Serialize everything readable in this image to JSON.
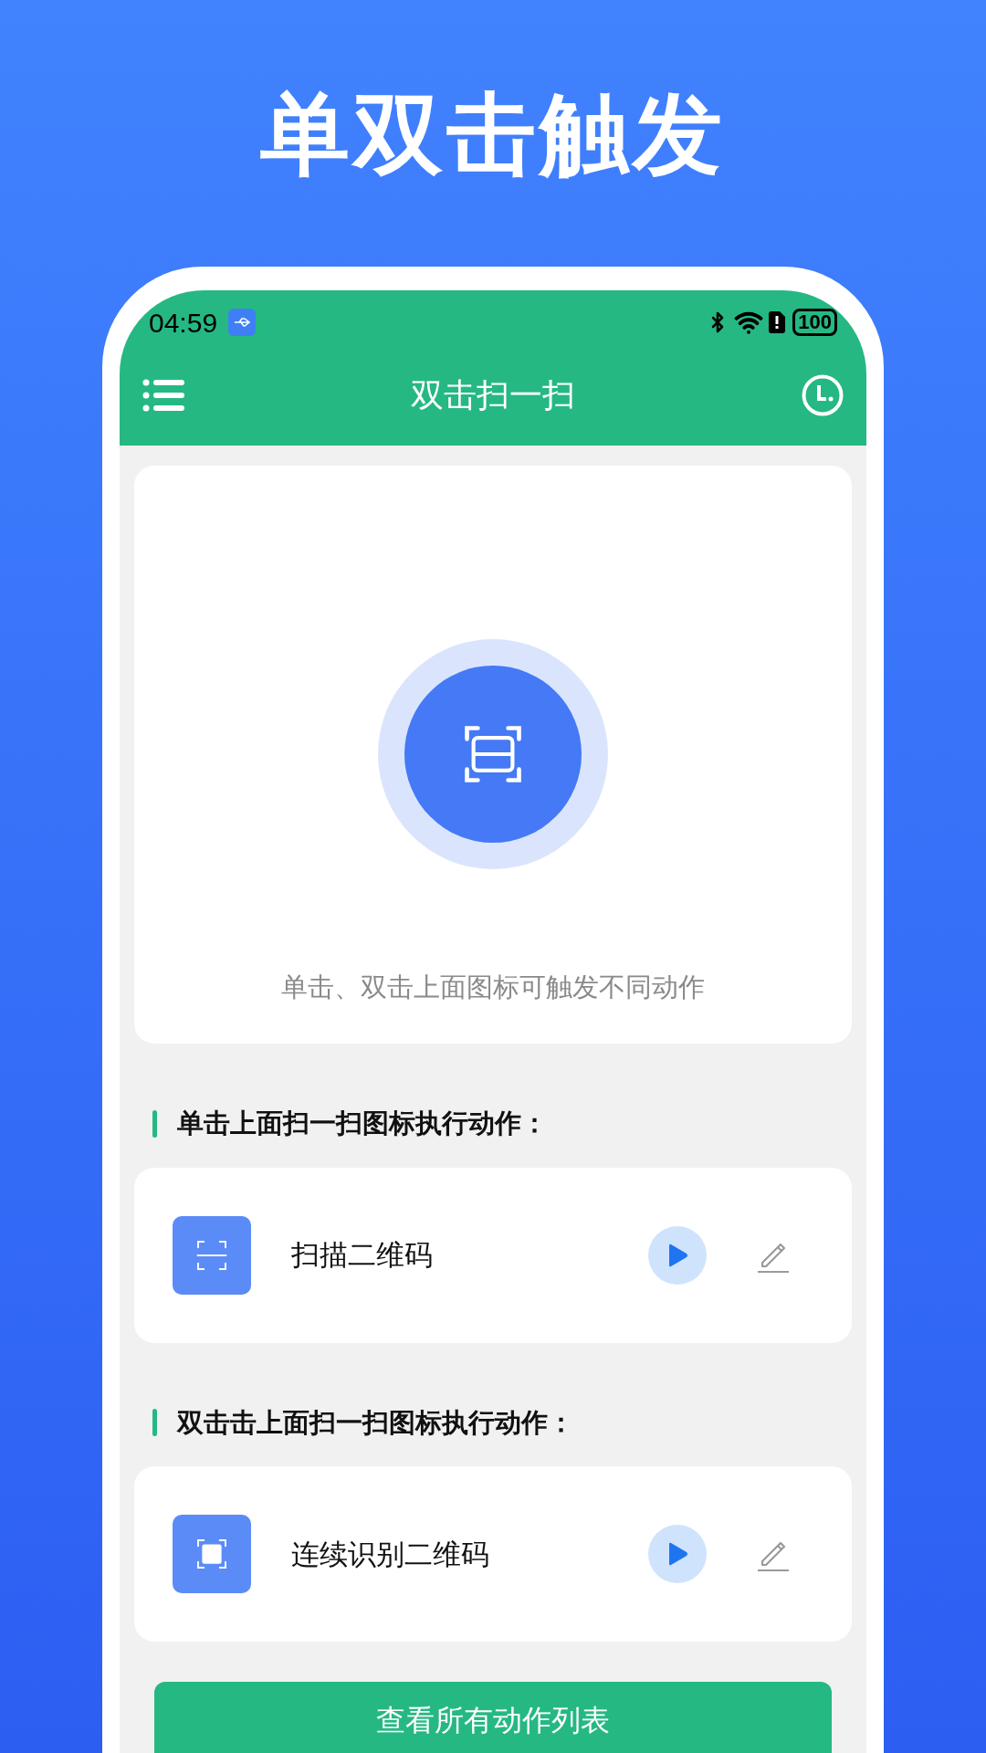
{
  "headline": "单双击触发",
  "status_bar": {
    "time": "04:59",
    "battery": "100"
  },
  "app_bar": {
    "title": "双击扫一扫"
  },
  "scan_card": {
    "hint": "单击、双击上面图标可触发不同动作"
  },
  "sections": [
    {
      "title": "单击上面扫一扫图标执行动作：",
      "action": {
        "label": "扫描二维码",
        "kind": "scan"
      }
    },
    {
      "title": "双击击上面扫一扫图标执行动作：",
      "action": {
        "label": "连续识别二维码",
        "kind": "continuous"
      }
    }
  ],
  "footer_button": {
    "label": "查看所有动作列表"
  }
}
